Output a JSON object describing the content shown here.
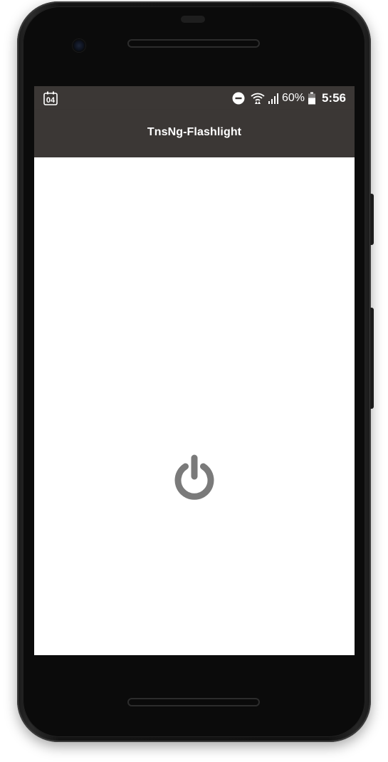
{
  "status_bar": {
    "calendar_day": "04",
    "battery_percent": "60%",
    "time": "5:56",
    "icons": [
      "calendar-icon",
      "do-not-disturb-icon",
      "wifi-icon",
      "signal-icon",
      "battery-icon"
    ]
  },
  "app": {
    "title": "TnsNg-Flashlight"
  },
  "main": {
    "toggle_icon": "power-icon"
  },
  "colors": {
    "bar_background": "#3b3735",
    "power_icon": "#7a7a7a",
    "screen_background": "#ffffff"
  }
}
